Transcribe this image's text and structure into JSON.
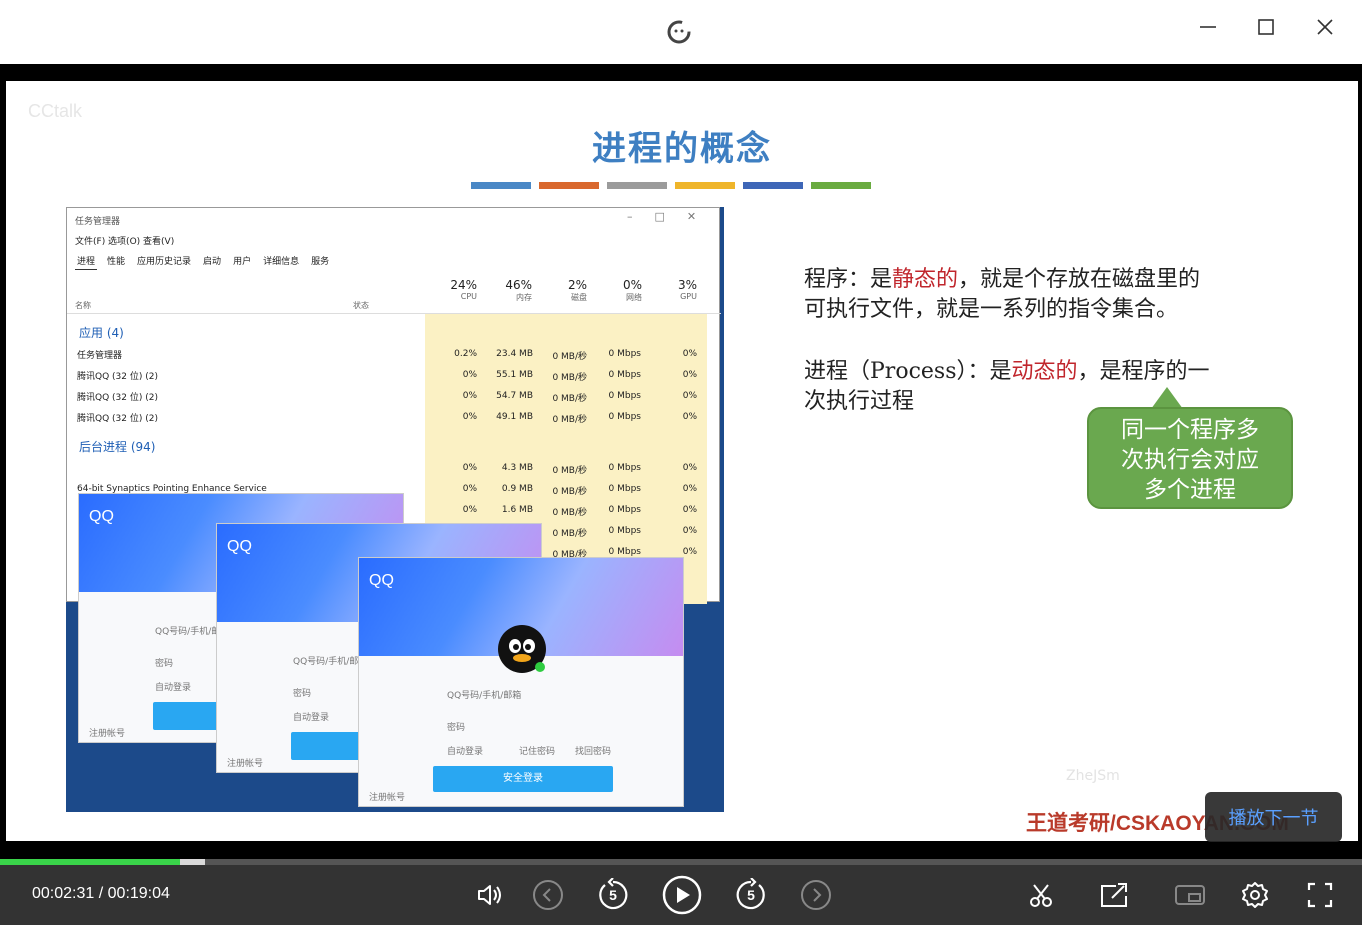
{
  "window": {
    "minimize": "—",
    "maximize": "☐",
    "close": "✕"
  },
  "slide": {
    "watermark_top": "CCtalk",
    "title": "进程的概念",
    "colorbar": [
      "#4a88c6",
      "#d9682e",
      "#9b9b9b",
      "#efb52a",
      "#3e66b7",
      "#6aab40"
    ],
    "p1_a": "程序：是",
    "p1_b": "静态的",
    "p1_c": "，就是个存放在磁盘里的",
    "p1_d": "可执行文件，就是一系列的指令集合。",
    "p2_a": "进程（Process）：是",
    "p2_b": "动态的",
    "p2_c": "，是程序的一",
    "p2_d": "次执行过程",
    "callout": [
      "同一个程序多",
      "次执行会对应",
      "多个进程"
    ],
    "brand": "王道考研/CSKAOYAN.COM",
    "watermark_bottom": "ZheJSm"
  },
  "task_manager": {
    "title": "任务管理器",
    "menu": "文件(F)   选项(O)   查看(V)",
    "tabs": [
      "进程",
      "性能",
      "应用历史记录",
      "启动",
      "用户",
      "详细信息",
      "服务"
    ],
    "col_name": "名称",
    "col_status": "状态",
    "columns": [
      {
        "pct": "24%",
        "label": "CPU"
      },
      {
        "pct": "46%",
        "label": "内存"
      },
      {
        "pct": "2%",
        "label": "磁盘"
      },
      {
        "pct": "0%",
        "label": "网络"
      },
      {
        "pct": "3%",
        "label": "GPU"
      }
    ],
    "group_apps": "应用 (4)",
    "group_bg": "后台进程 (94)",
    "app_rows": [
      {
        "name": "任务管理器",
        "cpu": "0.2%",
        "mem": "23.4 MB",
        "disk": "0 MB/秒",
        "net": "0 Mbps",
        "gpu": "0%"
      },
      {
        "name": "腾讯QQ (32 位) (2)",
        "cpu": "0%",
        "mem": "55.1 MB",
        "disk": "0 MB/秒",
        "net": "0 Mbps",
        "gpu": "0%"
      },
      {
        "name": "腾讯QQ (32 位) (2)",
        "cpu": "0%",
        "mem": "54.7 MB",
        "disk": "0 MB/秒",
        "net": "0 Mbps",
        "gpu": "0%"
      },
      {
        "name": "腾讯QQ (32 位) (2)",
        "cpu": "0%",
        "mem": "49.1 MB",
        "disk": "0 MB/秒",
        "net": "0 Mbps",
        "gpu": "0%"
      }
    ],
    "bg_rows": [
      {
        "name": "",
        "cpu": "0%",
        "mem": "4.3 MB",
        "disk": "0 MB/秒",
        "net": "0 Mbps",
        "gpu": "0%"
      },
      {
        "name": "64-bit Synaptics Pointing Enhance Service",
        "cpu": "0%",
        "mem": "0.9 MB",
        "disk": "0 MB/秒",
        "net": "0 Mbps",
        "gpu": "0%"
      },
      {
        "name": "",
        "cpu": "0%",
        "mem": "1.6 MB",
        "disk": "0 MB/秒",
        "net": "0 Mbps",
        "gpu": "0%"
      },
      {
        "name": "",
        "cpu": "",
        "mem": "",
        "disk": "0 MB/秒",
        "net": "0 Mbps",
        "gpu": "0%"
      },
      {
        "name": "",
        "cpu": "",
        "mem": "",
        "disk": "0 MB/秒",
        "net": "0 Mbps",
        "gpu": "0%"
      }
    ]
  },
  "qq": {
    "label": "QQ",
    "account_placeholder": "QQ号码/手机/邮箱",
    "password": "密码",
    "auto_login": "自动登录",
    "remember": "记住密码",
    "find_password": "找回密码",
    "login": "安全登录",
    "register": "注册帐号"
  },
  "player": {
    "play_next": "播放下一节",
    "current_time": "00:02:31",
    "separator": "/",
    "total_time": "00:19:04",
    "progress_fraction": 0.132,
    "seek_back_seconds": "5",
    "seek_forward_seconds": "5"
  }
}
